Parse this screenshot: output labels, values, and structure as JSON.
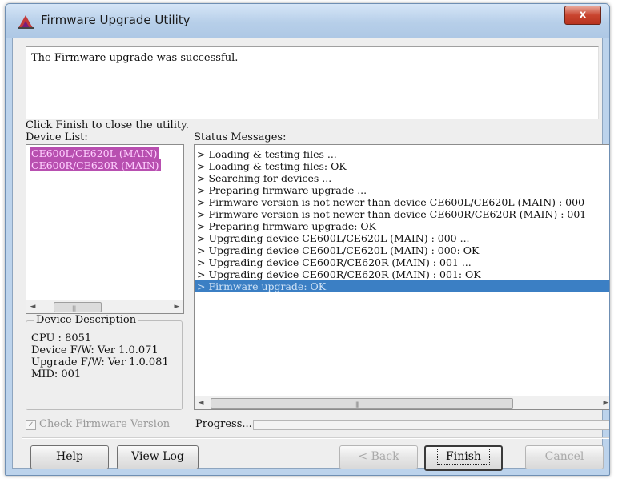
{
  "window": {
    "title": "Firmware Upgrade Utility",
    "close_glyph": "x"
  },
  "messages": {
    "line1": "The Firmware upgrade was successful.",
    "line2": "Click Finish to close the utility."
  },
  "device_list": {
    "label": "Device List:",
    "items": [
      "CE600L/CE620L (MAIN)",
      "CE600R/CE620R (MAIN)"
    ],
    "selection_color": "#b84fb0"
  },
  "device_description": {
    "title": "Device Description",
    "lines": [
      "CPU : 8051",
      "Device F/W: Ver 1.0.071",
      "Upgrade F/W: Ver 1.0.081",
      "MID: 001"
    ]
  },
  "status": {
    "label": "Status Messages:",
    "lines": [
      "> Loading & testing files ...",
      "> Loading & testing files: OK",
      "> Searching for devices ...",
      "> Preparing firmware upgrade ...",
      "> Firmware version is not newer than device CE600L/CE620L (MAIN) : 000",
      "> Firmware version is not newer than device CE600R/CE620R (MAIN) : 001",
      "> Preparing firmware upgrade: OK",
      "> Upgrading device CE600L/CE620L (MAIN) : 000 ...",
      "> Upgrading device CE600L/CE620L (MAIN) : 000: OK",
      "> Upgrading device CE600R/CE620R (MAIN) : 001 ...",
      "> Upgrading device CE600R/CE620R (MAIN) : 001: OK",
      "> Firmware upgrade: OK"
    ],
    "selected_index": 11,
    "selection_color": "#3b7fc4"
  },
  "options": {
    "check_firmware_label": "Check Firmware Version",
    "check_firmware_checked": true,
    "check_firmware_enabled": false
  },
  "progress": {
    "label": "Progress...",
    "value": 0
  },
  "buttons": {
    "help": "Help",
    "view_log": "View Log",
    "back": "< Back",
    "finish": "Finish",
    "cancel": "Cancel"
  },
  "scrollbar_glyphs": {
    "left": "◄",
    "right": "►",
    "grip": "|||"
  }
}
